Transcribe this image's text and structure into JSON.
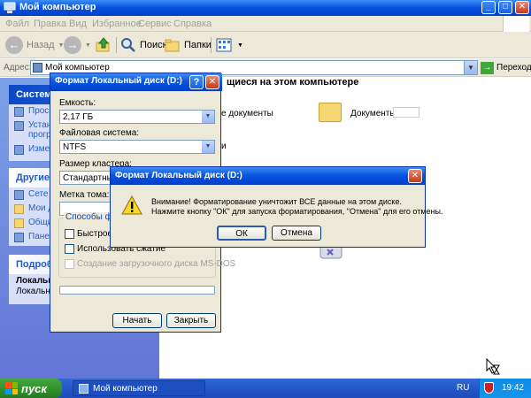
{
  "explorer": {
    "title": "Мой компьютер",
    "menu": [
      "Файл",
      "Правка",
      "Вид",
      "Избранное",
      "Сервис",
      "Справка"
    ],
    "toolbar": {
      "back": "Назад",
      "search": "Поиск",
      "folders": "Папки"
    },
    "address": {
      "label": "Адрес:",
      "value": "Мой компьютер",
      "go": "Переход"
    },
    "left_panels": {
      "system": {
        "title": "Системн",
        "items": [
          "Прос",
          "Устан",
          "прогр",
          "Измен"
        ]
      },
      "other": {
        "title": "Другие м",
        "items": [
          "Сете",
          "Мои д",
          "Общи",
          "Пане"
        ]
      },
      "details": {
        "title": "Подробн",
        "line1": "Локальны",
        "line2": "Локальны"
      }
    },
    "content": {
      "header": "щиеся на этом компьютере",
      "shared_docs": "е документы",
      "user_docs": "Документы -",
      "section2": "и"
    }
  },
  "format_dialog": {
    "title": "Формат Локальный диск (D:)",
    "capacity_label": "Емкость:",
    "capacity_value": "2,17 ГБ",
    "fs_label": "Файловая система:",
    "fs_value": "NTFS",
    "cluster_label": "Размер кластера:",
    "cluster_value": "Стандартный",
    "volume_label": "Метка тома:",
    "options_title": "Способы фор",
    "quick_format": "Быстрое (",
    "compression": "Использовать сжатие",
    "msdos_disk": "Создание загрузочного диска MS-DOS",
    "start_button": "Начать",
    "close_button": "Закрыть"
  },
  "warning_dialog": {
    "title": "Формат Локальный диск (D:)",
    "line1": "Внимание! Форматирование уничтожит ВСЕ данные на этом диске.",
    "line2": "Нажмите кнопку \"ОК\" для запуска форматирования, \"Отмена\" для его отмены.",
    "ok": "ОК",
    "cancel": "Отмена"
  },
  "taskbar": {
    "start": "пуск",
    "task": "Мой компьютер",
    "lang": "RU",
    "clock": "19:42"
  },
  "colors": {
    "xp_blue": "#0046d5",
    "start_green": "#2f8f2b",
    "dialog_bg": "#ece9d8"
  }
}
